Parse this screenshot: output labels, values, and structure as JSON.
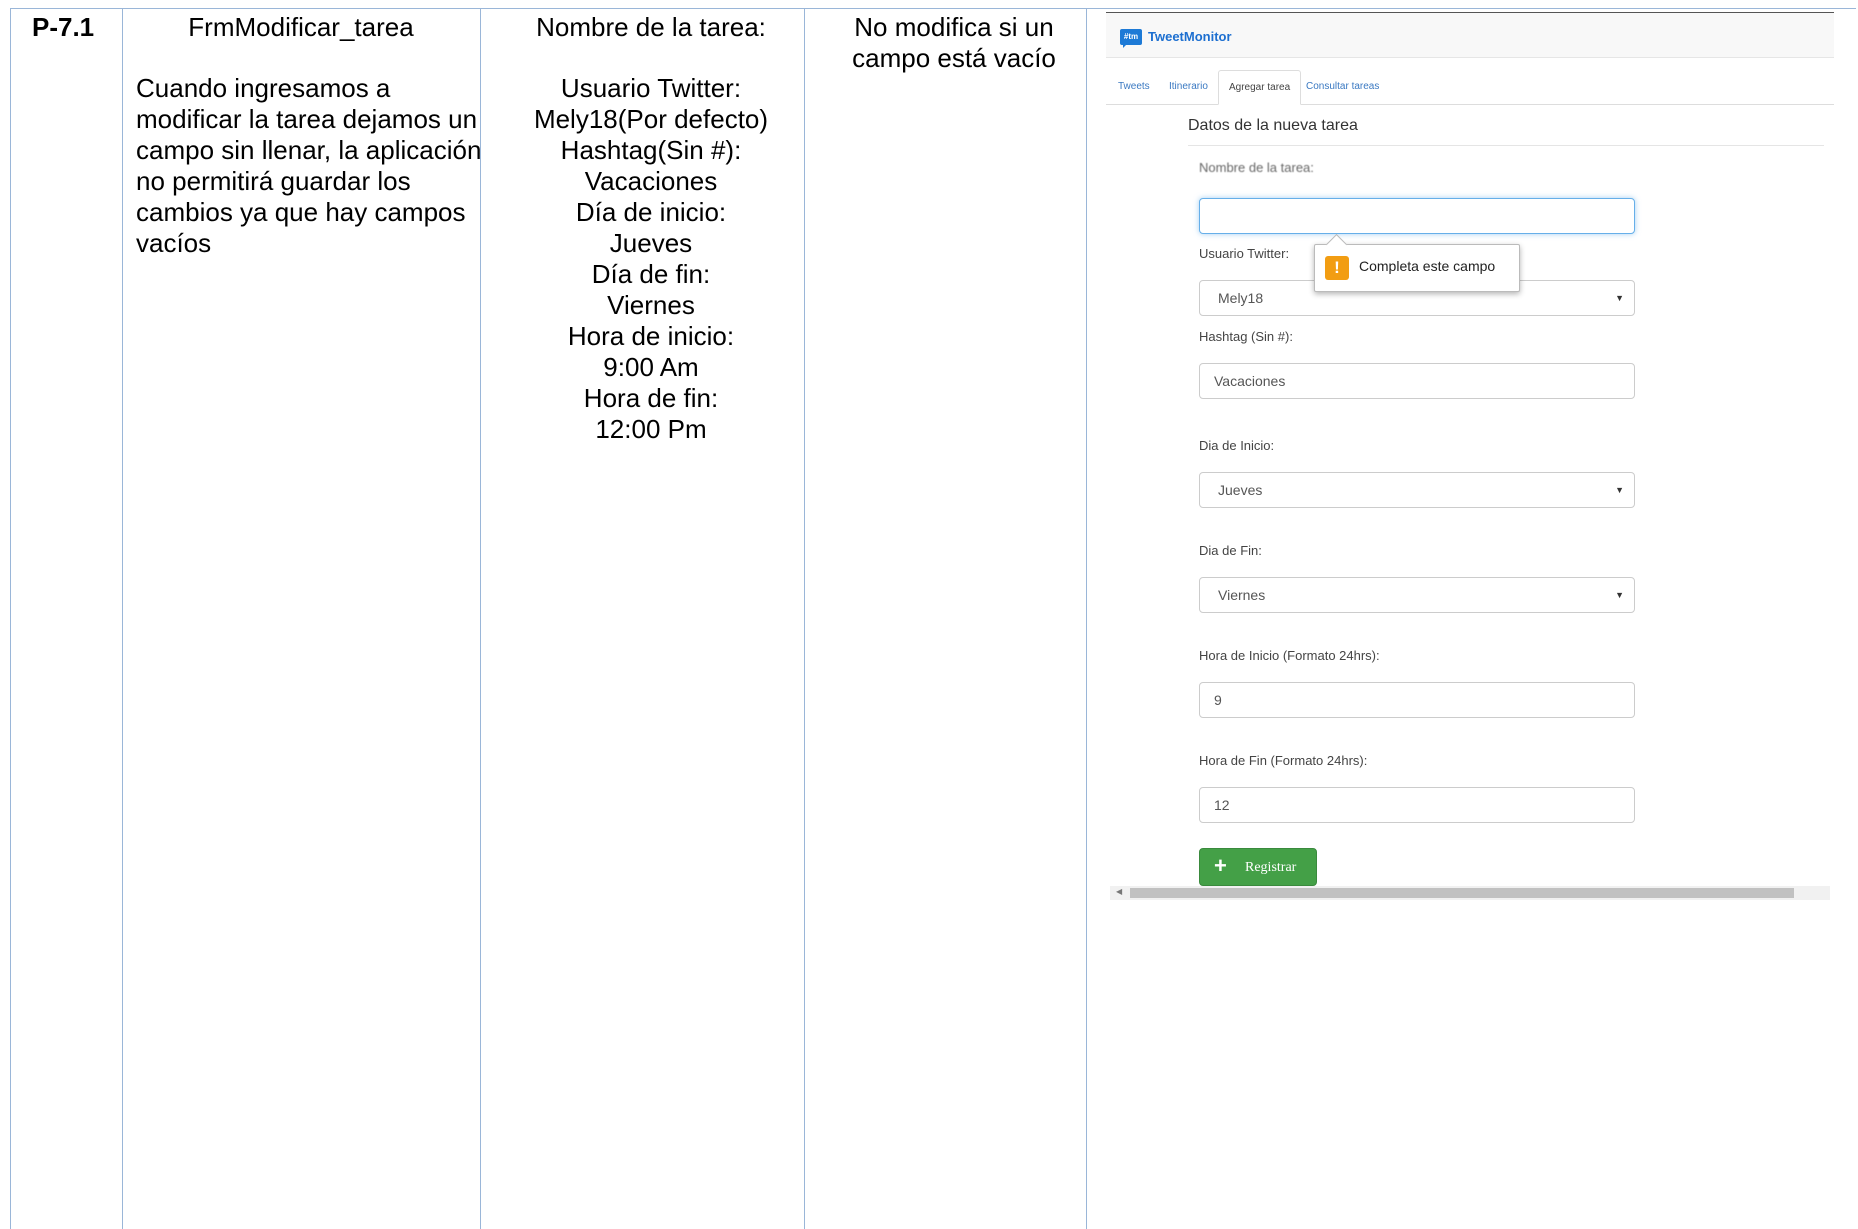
{
  "table": {
    "id": "P-7.1",
    "form_name": "FrmModificar_tarea",
    "description": "Cuando ingresamos a modificar la tarea dejamos un campo sin llenar, la aplicación no permitirá guardar los cambios ya que hay campos vacíos",
    "data_lines": [
      "Nombre de la tarea:",
      "Usuario Twitter:",
      "Mely18(Por defecto)",
      "Hashtag(Sin #):",
      "Vacaciones",
      "Día de inicio:",
      "Jueves",
      "Día de fin:",
      "Viernes",
      "Hora de inicio:",
      "9:00 Am",
      "Hora de fin:",
      "12:00 Pm"
    ],
    "result": "No modifica si un campo está vacío"
  },
  "app": {
    "logo_text": "#tm",
    "brand": "TweetMonitor",
    "tabs": [
      "Tweets",
      "Itinerario",
      "Agregar tarea",
      "Consultar tareas"
    ],
    "active_tab": "Agregar tarea",
    "section_title": "Datos de la nueva tarea",
    "form": {
      "nombre_label": "Nombre de la tarea:",
      "nombre_value": "",
      "usuario_label": "Usuario Twitter:",
      "usuario_value": "Mely18",
      "hashtag_label": "Hashtag (Sin #):",
      "hashtag_value": "Vacaciones",
      "dia_inicio_label": "Dia de Inicio:",
      "dia_inicio_value": "Jueves",
      "dia_fin_label": "Dia de Fin:",
      "dia_fin_value": "Viernes",
      "hora_inicio_label": "Hora de Inicio (Formato 24hrs):",
      "hora_inicio_value": "9",
      "hora_fin_label": "Hora de Fin (Formato 24hrs):",
      "hora_fin_value": "12",
      "submit_label": "Registrar"
    },
    "tooltip": "Completa este campo",
    "icons": {
      "warning": "warning-icon",
      "plus": "plus-icon",
      "caret": "caret-down-icon"
    },
    "colors": {
      "brand": "#1d6fd0",
      "button": "#44a047",
      "warning": "#f29d12",
      "focus": "#66afe9"
    }
  }
}
